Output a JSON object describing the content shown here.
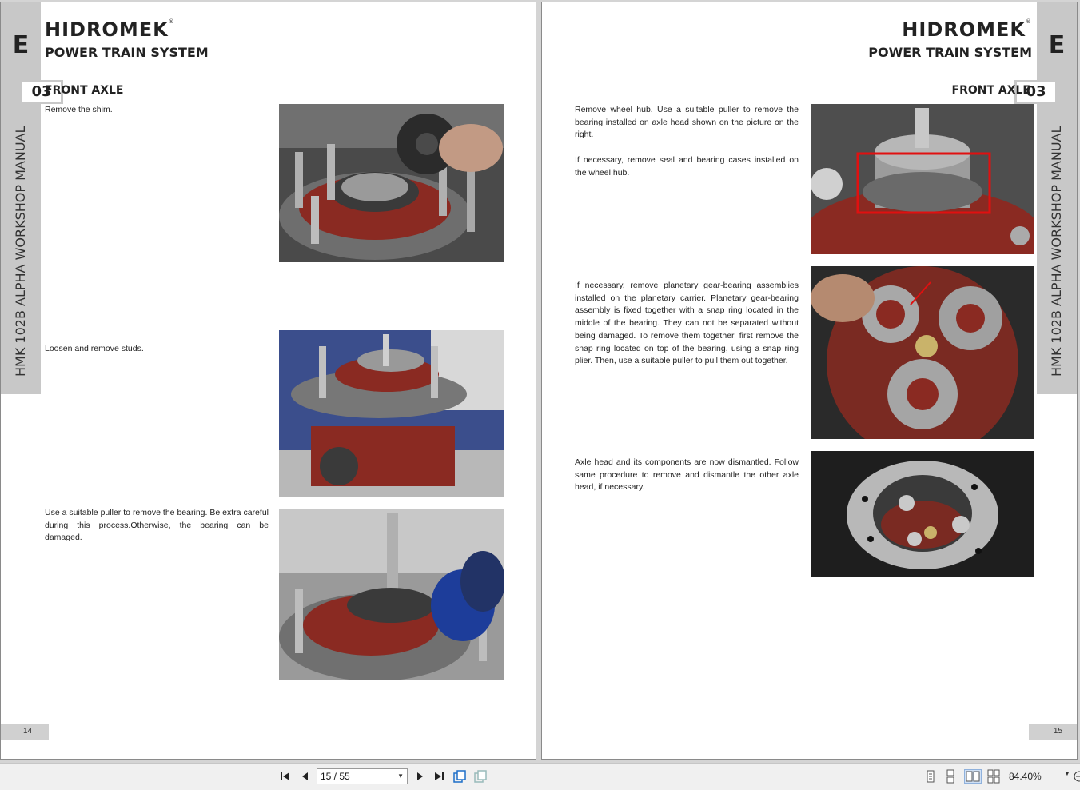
{
  "left_page": {
    "side_letter": "E",
    "chapter_number": "03",
    "side_text": "HMK 102B ALPHA WORKSHOP MANUAL",
    "logo": "HIDROMEK",
    "system_title": "POWER TRAIN SYSTEM",
    "section_title": "FRONT AXLE",
    "page_number": "14",
    "steps": [
      {
        "text": "Remove the shim."
      },
      {
        "text": "Loosen and remove studs."
      },
      {
        "text": "Use a suitable puller to remove the bearing. Be extra careful during this process.Otherwise, the bearing can be damaged."
      }
    ]
  },
  "right_page": {
    "side_letter": "E",
    "chapter_number": "03",
    "side_text": "HMK 102B ALPHA WORKSHOP MANUAL",
    "logo": "HIDROMEK",
    "system_title": "POWER TRAIN SYSTEM",
    "section_title": "FRONT AXLE",
    "page_number": "15",
    "steps": [
      {
        "text": "Remove wheel hub. Use a suitable puller to remove the bearing installed on axle head shown on the picture on the right."
      },
      {
        "text": "If necessary, remove seal and bearing cases installed on the wheel hub."
      },
      {
        "text": "If necessary, remove planetary gear-bearing assemblies installed on the planetary carrier. Planetary gear-bearing assembly is fixed together with a snap ring located in the middle of the bearing. They can not be separated without being damaged. To remove them together, first remove the snap ring located on top of  the bearing, using a snap ring plier. Then, use a suitable puller to pull them out together."
      },
      {
        "text": "Axle head and its components are now dismantled. Follow same procedure to remove and dismantle the other axle head, if necessary."
      }
    ]
  },
  "toolbar": {
    "page_indicator": "15 / 55",
    "zoom": "84.40%"
  },
  "colors": {
    "tab_gray": "#c8c8c8",
    "axle_red": "#8a2a22",
    "highlight_red": "#e01010"
  }
}
